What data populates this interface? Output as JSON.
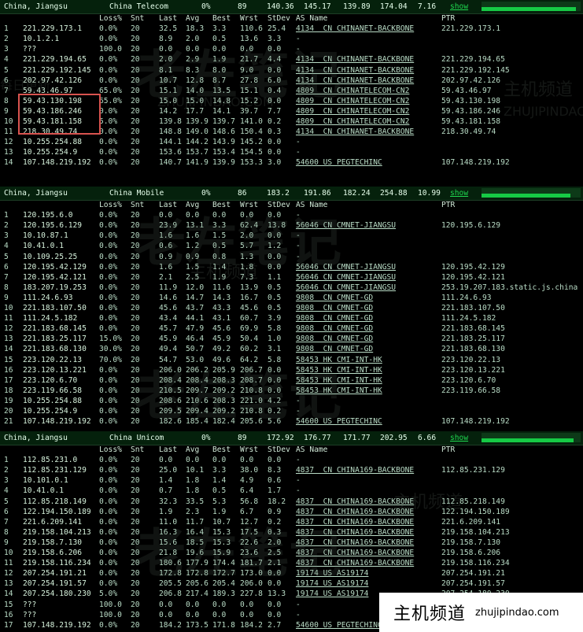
{
  "panels": [
    {
      "region": "China, Jiangsu",
      "isp": "China Telecom",
      "loss": "0%",
      "snt": "89",
      "last": "140.36",
      "avg": "145.17",
      "best": "139.89",
      "wrst": "174.04",
      "stdev": "7.16",
      "show": "show",
      "bar_level": 0.95,
      "columns": {
        "loss": "Loss%",
        "snt": "Snt",
        "last": "Last",
        "avg": "Avg",
        "best": "Best",
        "wrst": "Wrst",
        "stdev": "StDev",
        "as": "AS Name",
        "ptr": "PTR"
      },
      "rows": [
        {
          "hop": "1",
          "ip": "221.229.173.1",
          "loss": "0.0%",
          "snt": "20",
          "last": "32.5",
          "avg": "18.3",
          "best": "3.3",
          "wrst": "110.6",
          "stdev": "25.4",
          "as": "4134  CN CHINANET-BACKBONE",
          "ptr": "221.229.173.1"
        },
        {
          "hop": "2",
          "ip": "10.1.2.1",
          "loss": "0.0%",
          "snt": "20",
          "last": "8.9",
          "avg": "2.0",
          "best": "0.5",
          "wrst": "13.6",
          "stdev": "3.3",
          "as": "-",
          "ptr": ""
        },
        {
          "hop": "3",
          "ip": "???",
          "loss": "100.0",
          "snt": "20",
          "last": "0.0",
          "avg": "0.0",
          "best": "0.0",
          "wrst": "0.0",
          "stdev": "0.0",
          "as": "-",
          "ptr": ""
        },
        {
          "hop": "4",
          "ip": "221.229.194.65",
          "loss": "0.0%",
          "snt": "20",
          "last": "2.0",
          "avg": "2.9",
          "best": "1.9",
          "wrst": "21.7",
          "stdev": "4.4",
          "as": "4134  CN CHINANET-BACKBONE",
          "ptr": "221.229.194.65"
        },
        {
          "hop": "5",
          "ip": "221.229.192.145",
          "loss": "0.0%",
          "snt": "20",
          "last": "8.1",
          "avg": "8.3",
          "best": "8.0",
          "wrst": "9.0",
          "stdev": "0.0",
          "as": "4134  CN CHINANET-BACKBONE",
          "ptr": "221.229.192.145"
        },
        {
          "hop": "6",
          "ip": "202.97.42.126",
          "loss": "0.0%",
          "snt": "20",
          "last": "10.7",
          "avg": "12.8",
          "best": "8.7",
          "wrst": "27.8",
          "stdev": "6.0",
          "as": "4134  CN CHINANET-BACKBONE",
          "ptr": "202.97.42.126"
        },
        {
          "hop": "7",
          "ip": "59.43.46.97",
          "loss": "65.0%",
          "snt": "20",
          "last": "15.1",
          "avg": "14.0",
          "best": "13.5",
          "wrst": "15.1",
          "stdev": "0.4",
          "as": "4809  CN CHINATELECOM-CN2",
          "ptr": "59.43.46.97"
        },
        {
          "hop": "8",
          "ip": "59.43.130.198",
          "loss": "65.0%",
          "snt": "20",
          "last": "15.0",
          "avg": "15.0",
          "best": "14.8",
          "wrst": "15.2",
          "stdev": "0.0",
          "as": "4809  CN CHINATELECOM-CN2",
          "ptr": "59.43.130.198"
        },
        {
          "hop": "9",
          "ip": "59.43.186.246",
          "loss": "0.0%",
          "snt": "20",
          "last": "14.2",
          "avg": "17.7",
          "best": "14.1",
          "wrst": "39.7",
          "stdev": "7.7",
          "as": "4809  CN CHINATELECOM-CN2",
          "ptr": "59.43.186.246"
        },
        {
          "hop": "10",
          "ip": "59.43.181.158",
          "loss": "5.0%",
          "snt": "20",
          "last": "139.8",
          "avg": "139.9",
          "best": "139.7",
          "wrst": "141.0",
          "stdev": "0.2",
          "as": "4809  CN CHINATELECOM-CN2",
          "ptr": "59.43.181.158"
        },
        {
          "hop": "11",
          "ip": "218.30.49.74",
          "loss": "0.0%",
          "snt": "20",
          "last": "148.8",
          "avg": "149.0",
          "best": "148.6",
          "wrst": "150.4",
          "stdev": "0.3",
          "as": "4134  CN CHINANET-BACKBONE",
          "ptr": "218.30.49.74"
        },
        {
          "hop": "12",
          "ip": "10.255.254.88",
          "loss": "0.0%",
          "snt": "20",
          "last": "144.1",
          "avg": "144.2",
          "best": "143.9",
          "wrst": "145.2",
          "stdev": "0.0",
          "as": "-",
          "ptr": ""
        },
        {
          "hop": "13",
          "ip": "10.255.254.9",
          "loss": "0.0%",
          "snt": "20",
          "last": "153.6",
          "avg": "153.7",
          "best": "153.4",
          "wrst": "154.5",
          "stdev": "0.0",
          "as": "-",
          "ptr": ""
        },
        {
          "hop": "14",
          "ip": "107.148.219.192",
          "loss": "0.0%",
          "snt": "20",
          "last": "140.7",
          "avg": "141.9",
          "best": "139.9",
          "wrst": "153.3",
          "stdev": "3.0",
          "as": "54600 US PEGTECHINC",
          "ptr": "107.148.219.192"
        }
      ]
    },
    {
      "region": "China, Jiangsu",
      "isp": "China Mobile",
      "loss": "0%",
      "snt": "86",
      "last": "183.2",
      "avg": "191.86",
      "best": "182.24",
      "wrst": "254.88",
      "stdev": "10.99",
      "show": "show",
      "bar_level": 0.9,
      "columns": {
        "loss": "Loss%",
        "snt": "Snt",
        "last": "Last",
        "avg": "Avg",
        "best": "Best",
        "wrst": "Wrst",
        "stdev": "StDev",
        "as": "AS Name",
        "ptr": "PTR"
      },
      "rows": [
        {
          "hop": "1",
          "ip": "120.195.6.0",
          "loss": "0.0%",
          "snt": "20",
          "last": "0.0",
          "avg": "0.0",
          "best": "0.0",
          "wrst": "0.0",
          "stdev": "0.0",
          "as": "-",
          "ptr": ""
        },
        {
          "hop": "2",
          "ip": "120.195.6.129",
          "loss": "0.0%",
          "snt": "20",
          "last": "23.9",
          "avg": "13.1",
          "best": "3.3",
          "wrst": "62.4",
          "stdev": "13.8",
          "as": "56046 CN CMNET-JIANGSU",
          "ptr": "120.195.6.129"
        },
        {
          "hop": "3",
          "ip": "10.10.87.1",
          "loss": "0.0%",
          "snt": "20",
          "last": "1.6",
          "avg": "1.6",
          "best": "1.5",
          "wrst": "2.0",
          "stdev": "0.0",
          "as": "-",
          "ptr": ""
        },
        {
          "hop": "4",
          "ip": "10.41.0.1",
          "loss": "0.0%",
          "snt": "20",
          "last": "0.6",
          "avg": "1.2",
          "best": "0.5",
          "wrst": "5.7",
          "stdev": "1.2",
          "as": "-",
          "ptr": ""
        },
        {
          "hop": "5",
          "ip": "10.109.25.25",
          "loss": "0.0%",
          "snt": "20",
          "last": "0.9",
          "avg": "0.9",
          "best": "0.8",
          "wrst": "1.3",
          "stdev": "0.0",
          "as": "-",
          "ptr": ""
        },
        {
          "hop": "6",
          "ip": "120.195.42.129",
          "loss": "0.0%",
          "snt": "20",
          "last": "1.6",
          "avg": "1.5",
          "best": "1.4",
          "wrst": "1.8",
          "stdev": "0.0",
          "as": "56046 CN CMNET-JIANGSU",
          "ptr": "120.195.42.129"
        },
        {
          "hop": "7",
          "ip": "120.195.42.121",
          "loss": "0.0%",
          "snt": "20",
          "last": "2.1",
          "avg": "2.5",
          "best": "1.9",
          "wrst": "7.3",
          "stdev": "1.1",
          "as": "56046 CN CMNET-JIANGSU",
          "ptr": "120.195.42.121"
        },
        {
          "hop": "8",
          "ip": "183.207.19.253",
          "loss": "0.0%",
          "snt": "20",
          "last": "11.9",
          "avg": "12.0",
          "best": "11.6",
          "wrst": "13.9",
          "stdev": "0.5",
          "as": "56046 CN CMNET-JIANGSU",
          "ptr": "253.19.207.183.static.js.china"
        },
        {
          "hop": "9",
          "ip": "111.24.6.93",
          "loss": "0.0%",
          "snt": "20",
          "last": "14.6",
          "avg": "14.7",
          "best": "14.3",
          "wrst": "16.7",
          "stdev": "0.5",
          "as": "9808  CN CMNET-GD",
          "ptr": "111.24.6.93"
        },
        {
          "hop": "10",
          "ip": "221.183.107.50",
          "loss": "0.0%",
          "snt": "20",
          "last": "45.6",
          "avg": "43.7",
          "best": "43.3",
          "wrst": "45.6",
          "stdev": "0.5",
          "as": "9808  CN CMNET-GD",
          "ptr": "221.183.107.50"
        },
        {
          "hop": "11",
          "ip": "111.24.5.182",
          "loss": "0.0%",
          "snt": "20",
          "last": "43.4",
          "avg": "44.1",
          "best": "43.1",
          "wrst": "60.7",
          "stdev": "3.9",
          "as": "9808  CN CMNET-GD",
          "ptr": "111.24.5.182"
        },
        {
          "hop": "12",
          "ip": "221.183.68.145",
          "loss": "0.0%",
          "snt": "20",
          "last": "45.7",
          "avg": "47.9",
          "best": "45.6",
          "wrst": "69.9",
          "stdev": "5.8",
          "as": "9808  CN CMNET-GD",
          "ptr": "221.183.68.145"
        },
        {
          "hop": "13",
          "ip": "221.183.25.117",
          "loss": "15.0%",
          "snt": "20",
          "last": "45.9",
          "avg": "46.4",
          "best": "45.9",
          "wrst": "50.4",
          "stdev": "1.0",
          "as": "9808  CN CMNET-GD",
          "ptr": "221.183.25.117"
        },
        {
          "hop": "14",
          "ip": "221.183.68.130",
          "loss": "30.0%",
          "snt": "20",
          "last": "49.4",
          "avg": "50.7",
          "best": "49.2",
          "wrst": "60.2",
          "stdev": "3.1",
          "as": "9808  CN CMNET-GD",
          "ptr": "221.183.68.130"
        },
        {
          "hop": "15",
          "ip": "223.120.22.13",
          "loss": "70.0%",
          "snt": "20",
          "last": "54.7",
          "avg": "53.0",
          "best": "49.6",
          "wrst": "64.2",
          "stdev": "5.8",
          "as": "58453 HK CMI-INT-HK",
          "ptr": "223.120.22.13"
        },
        {
          "hop": "16",
          "ip": "223.120.13.221",
          "loss": "0.0%",
          "snt": "20",
          "last": "206.0",
          "avg": "206.2",
          "best": "205.9",
          "wrst": "206.7",
          "stdev": "0.0",
          "as": "58453 HK CMI-INT-HK",
          "ptr": "223.120.13.221"
        },
        {
          "hop": "17",
          "ip": "223.120.6.70",
          "loss": "0.0%",
          "snt": "20",
          "last": "208.4",
          "avg": "208.4",
          "best": "208.3",
          "wrst": "208.7",
          "stdev": "0.0",
          "as": "58453 HK CMI-INT-HK",
          "ptr": "223.120.6.70"
        },
        {
          "hop": "18",
          "ip": "223.119.66.58",
          "loss": "0.0%",
          "snt": "20",
          "last": "210.5",
          "avg": "209.7",
          "best": "209.2",
          "wrst": "210.8",
          "stdev": "0.0",
          "as": "58453 HK CMI-INT-HK",
          "ptr": "223.119.66.58"
        },
        {
          "hop": "19",
          "ip": "10.255.254.88",
          "loss": "0.0%",
          "snt": "20",
          "last": "208.6",
          "avg": "210.6",
          "best": "208.3",
          "wrst": "221.0",
          "stdev": "4.2",
          "as": "-",
          "ptr": ""
        },
        {
          "hop": "20",
          "ip": "10.255.254.9",
          "loss": "0.0%",
          "snt": "20",
          "last": "209.5",
          "avg": "209.4",
          "best": "209.2",
          "wrst": "210.8",
          "stdev": "0.2",
          "as": "-",
          "ptr": ""
        },
        {
          "hop": "21",
          "ip": "107.148.219.192",
          "loss": "0.0%",
          "snt": "20",
          "last": "182.6",
          "avg": "185.4",
          "best": "182.4",
          "wrst": "205.6",
          "stdev": "5.6",
          "as": "54600 US PEGTECHINC",
          "ptr": "107.148.219.192"
        }
      ]
    },
    {
      "region": "China, Jiangsu",
      "isp": "China Unicom",
      "loss": "0%",
      "snt": "89",
      "last": "172.92",
      "avg": "176.77",
      "best": "171.77",
      "wrst": "202.95",
      "stdev": "6.66",
      "show": "show",
      "bar_level": 0.93,
      "columns": {
        "loss": "Loss%",
        "snt": "Snt",
        "last": "Last",
        "avg": "Avg",
        "best": "Best",
        "wrst": "Wrst",
        "stdev": "StDev",
        "as": "AS Name",
        "ptr": "PTR"
      },
      "rows": [
        {
          "hop": "1",
          "ip": "112.85.231.0",
          "loss": "0.0%",
          "snt": "20",
          "last": "0.0",
          "avg": "0.0",
          "best": "0.0",
          "wrst": "0.0",
          "stdev": "0.0",
          "as": "-",
          "ptr": ""
        },
        {
          "hop": "2",
          "ip": "112.85.231.129",
          "loss": "0.0%",
          "snt": "20",
          "last": "25.0",
          "avg": "10.1",
          "best": "3.3",
          "wrst": "38.0",
          "stdev": "8.3",
          "as": "4837  CN CHINA169-BACKBONE",
          "ptr": "112.85.231.129"
        },
        {
          "hop": "3",
          "ip": "10.101.0.1",
          "loss": "0.0%",
          "snt": "20",
          "last": "1.4",
          "avg": "1.8",
          "best": "1.4",
          "wrst": "4.9",
          "stdev": "0.6",
          "as": "-",
          "ptr": ""
        },
        {
          "hop": "4",
          "ip": "10.41.0.1",
          "loss": "0.0%",
          "snt": "20",
          "last": "0.7",
          "avg": "1.8",
          "best": "0.5",
          "wrst": "6.4",
          "stdev": "1.7",
          "as": "-",
          "ptr": ""
        },
        {
          "hop": "5",
          "ip": "112.85.218.149",
          "loss": "0.0%",
          "snt": "20",
          "last": "32.3",
          "avg": "33.5",
          "best": "5.3",
          "wrst": "56.8",
          "stdev": "18.2",
          "as": "4837  CN CHINA169-BACKBONE",
          "ptr": "112.85.218.149"
        },
        {
          "hop": "6",
          "ip": "122.194.150.189",
          "loss": "0.0%",
          "snt": "20",
          "last": "1.9",
          "avg": "2.3",
          "best": "1.9",
          "wrst": "6.7",
          "stdev": "0.9",
          "as": "4837  CN CHINA169-BACKBONE",
          "ptr": "122.194.150.189"
        },
        {
          "hop": "7",
          "ip": "221.6.209.141",
          "loss": "0.0%",
          "snt": "20",
          "last": "11.0",
          "avg": "11.7",
          "best": "10.7",
          "wrst": "12.7",
          "stdev": "0.2",
          "as": "4837  CN CHINA169-BACKBONE",
          "ptr": "221.6.209.141"
        },
        {
          "hop": "8",
          "ip": "219.158.104.213",
          "loss": "0.0%",
          "snt": "20",
          "last": "16.3",
          "avg": "16.4",
          "best": "15.3",
          "wrst": "17.5",
          "stdev": "0.3",
          "as": "4837  CN CHINA169-BACKBONE",
          "ptr": "219.158.104.213"
        },
        {
          "hop": "9",
          "ip": "219.158.7.130",
          "loss": "0.0%",
          "snt": "20",
          "last": "15.6",
          "avg": "18.5",
          "best": "15.3",
          "wrst": "22.6",
          "stdev": "2.0",
          "as": "4837  CN CHINA169-BACKBONE",
          "ptr": "219.158.7.130"
        },
        {
          "hop": "10",
          "ip": "219.158.6.206",
          "loss": "0.0%",
          "snt": "20",
          "last": "21.8",
          "avg": "19.6",
          "best": "15.9",
          "wrst": "23.6",
          "stdev": "2.5",
          "as": "4837  CN CHINA169-BACKBONE",
          "ptr": "219.158.6.206"
        },
        {
          "hop": "11",
          "ip": "219.158.116.234",
          "loss": "0.0%",
          "snt": "20",
          "last": "180.6",
          "avg": "177.9",
          "best": "174.4",
          "wrst": "181.7",
          "stdev": "2.1",
          "as": "4837  CN CHINA169-BACKBONE",
          "ptr": "219.158.116.234"
        },
        {
          "hop": "12",
          "ip": "207.254.191.21",
          "loss": "0.0%",
          "snt": "20",
          "last": "172.8",
          "avg": "172.8",
          "best": "172.7",
          "wrst": "173.0",
          "stdev": "0.0",
          "as": "19174 US AS19174",
          "ptr": "207.254.191.21"
        },
        {
          "hop": "13",
          "ip": "207.254.191.57",
          "loss": "0.0%",
          "snt": "20",
          "last": "205.5",
          "avg": "205.6",
          "best": "205.4",
          "wrst": "206.0",
          "stdev": "0.0",
          "as": "19174 US AS19174",
          "ptr": "207.254.191.57"
        },
        {
          "hop": "14",
          "ip": "207.254.180.230",
          "loss": "5.0%",
          "snt": "20",
          "last": "206.8",
          "avg": "217.4",
          "best": "189.3",
          "wrst": "227.8",
          "stdev": "13.3",
          "as": "19174 US AS19174",
          "ptr": "207.254.180.230"
        },
        {
          "hop": "15",
          "ip": "???",
          "loss": "100.0",
          "snt": "20",
          "last": "0.0",
          "avg": "0.0",
          "best": "0.0",
          "wrst": "0.0",
          "stdev": "0.0",
          "as": "-",
          "ptr": ""
        },
        {
          "hop": "16",
          "ip": "???",
          "loss": "100.0",
          "snt": "20",
          "last": "0.0",
          "avg": "0.0",
          "best": "0.0",
          "wrst": "0.0",
          "stdev": "0.0",
          "as": "-",
          "ptr": ""
        },
        {
          "hop": "17",
          "ip": "107.148.219.192",
          "loss": "0.0%",
          "snt": "20",
          "last": "184.2",
          "avg": "173.5",
          "best": "171.8",
          "wrst": "184.2",
          "stdev": "2.7",
          "as": "54600 US PEGTECHINC",
          "ptr": ""
        }
      ]
    }
  ],
  "watermark": {
    "cn_big": "老左笔记",
    "cn_site": "主机频道",
    "latin": "ZHUJIPINDAO.COM",
    "cn_update": "每日更新"
  },
  "footer": {
    "cn": "主机频道",
    "domain": "zhujipindao.com"
  },
  "colors": {
    "header_bg": "#05210c",
    "show_link": "#1fd84f",
    "ip_text": "#d6f2dc",
    "highlight": "#d9534f"
  }
}
